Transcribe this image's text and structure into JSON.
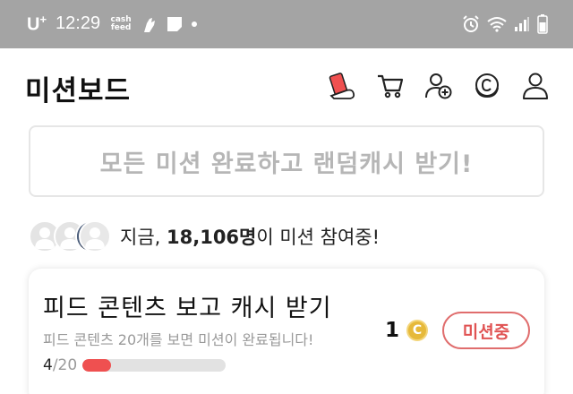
{
  "status_bar": {
    "carrier": "U",
    "carrier_sup": "+",
    "time": "12:29",
    "cashfeed_line1": "cash",
    "cashfeed_line2": "feed",
    "left_icons": [
      "cashfeed-icon",
      "hand-icon",
      "note-icon",
      "dot-icon"
    ],
    "right_icons": [
      "alarm-icon",
      "wifi-icon",
      "signal-icon",
      "battery-icon"
    ]
  },
  "header": {
    "title": "미션보드",
    "icons": [
      "mission-card-icon",
      "cart-icon",
      "add-friend-icon",
      "coin-icon",
      "profile-icon"
    ]
  },
  "banner": {
    "text": "모든 미션 완료하고 랜덤캐시 받기!"
  },
  "participants": {
    "prefix": "지금, ",
    "count": "18,106명",
    "suffix": "이 미션 참여중!"
  },
  "mission": {
    "title": "피드 콘텐츠 보고 캐시 받기",
    "subtitle": "피드 콘텐츠 20개를 보면 미션이 완료됩니다!",
    "progress_current": "4",
    "progress_total": "/20",
    "progress_fraction": 0.2,
    "reward": "1",
    "coin_symbol": "C",
    "status_label": "미션중"
  },
  "colors": {
    "accent": "#ef5050",
    "status_bar": "#a4a4a4",
    "coin": "#e6b93a"
  }
}
